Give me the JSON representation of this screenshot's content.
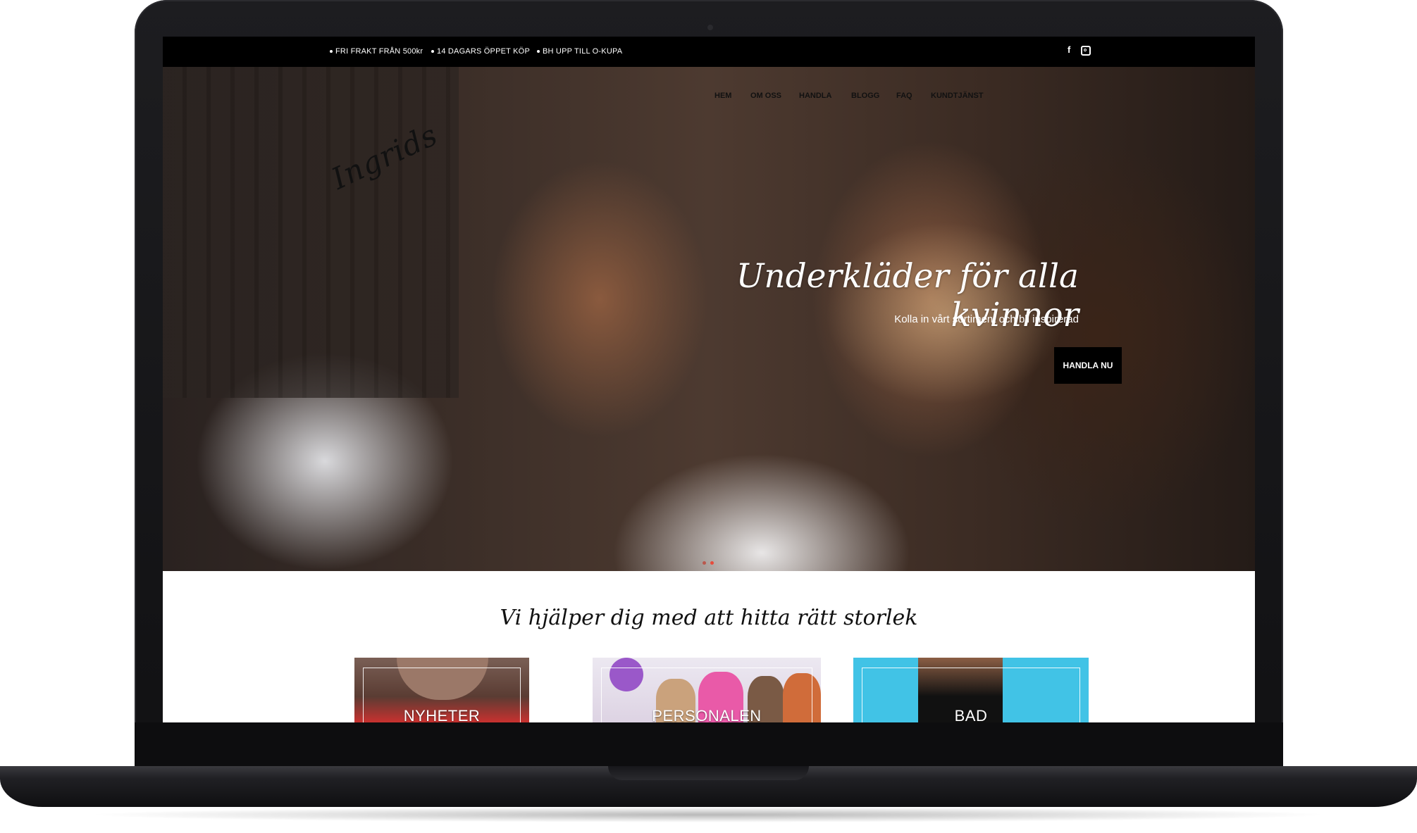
{
  "topbar": {
    "usps": [
      "FRI FRAKT FRÅN 500kr",
      "14 DAGARS ÖPPET KÖP",
      "BH UPP TILL O-KUPA"
    ],
    "social": [
      {
        "name": "facebook-icon",
        "glyph": "f"
      },
      {
        "name": "instagram-icon",
        "glyph": ""
      }
    ]
  },
  "header": {
    "logo": "Ingrids",
    "nav": [
      "HEM",
      "OM OSS",
      "HANDLA",
      "BLOGG",
      "FAQ",
      "KUNDTJÄNST"
    ]
  },
  "hero": {
    "title": "Underkläder för alla kvinnor",
    "subtitle": "Kolla in vårt sortiment och bli inspirerad",
    "button": "HANDLA NU",
    "slides_total": 2,
    "slide_active": 2
  },
  "section": {
    "title": "Vi hjälper dig med att hitta rätt storlek",
    "cards": [
      {
        "label": "NYHETER"
      },
      {
        "label": "PERSONALEN"
      },
      {
        "label": "BAD"
      }
    ]
  },
  "colors": {
    "topbar": "#000000",
    "button": "#000000",
    "slider_dot": "#e74c3c",
    "bad_card": "#41c3e6",
    "personalen_card": "#e9e4f0"
  }
}
